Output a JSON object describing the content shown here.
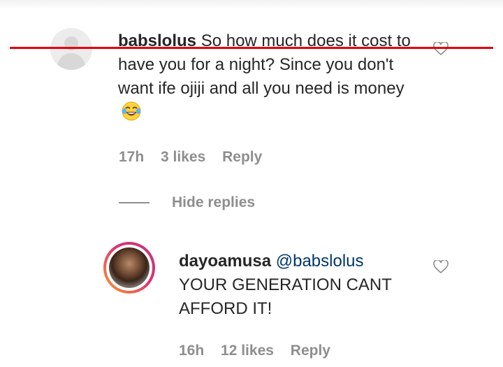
{
  "comment": {
    "username": "babslolus",
    "text": "So how much does it cost to have you for a night? Since you don't want ife ojiji and all you need is money",
    "emoji": "tears-of-joy-emoji",
    "time": "17h",
    "likes": "3 likes",
    "reply_label": "Reply"
  },
  "replies_toggle": {
    "label": "Hide replies"
  },
  "reply": {
    "username": "dayoamusa",
    "mention": "@babslolus",
    "text": "YOUR GENERATION CANT AFFORD IT!",
    "time": "16h",
    "likes": "12 likes",
    "reply_label": "Reply"
  },
  "colors": {
    "strike": "#e3000f",
    "meta": "#8e8e8e",
    "text": "#262626"
  }
}
